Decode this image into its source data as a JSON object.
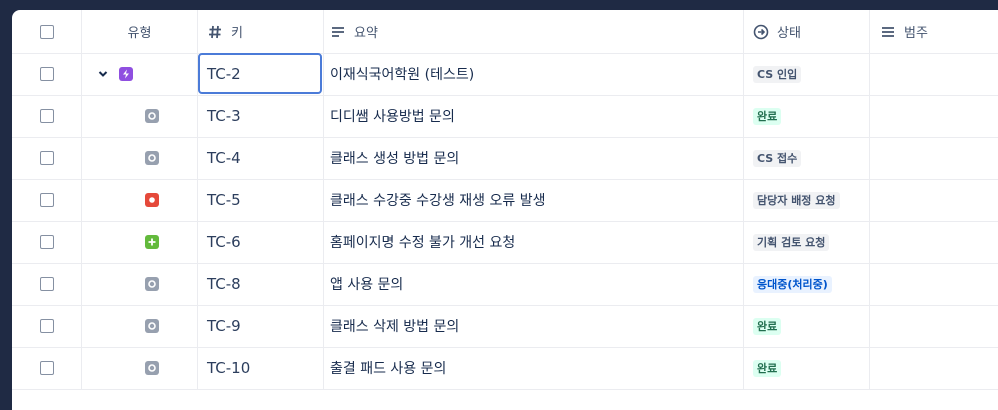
{
  "header": {
    "type_label": "유형",
    "key_label": "키",
    "summary_label": "요약",
    "status_label": "상태",
    "category_label": "범주"
  },
  "icons": {
    "key_header": "hash-icon",
    "summary_header": "text-lines-icon",
    "status_header": "arrow-circle-right-icon",
    "category_header": "menu-lines-icon"
  },
  "colors": {
    "epic": "#8f4fe0",
    "task": "#97a0af",
    "bug": "#e5493a",
    "improvement": "#63ba3c",
    "selection": "#4b7bd8"
  },
  "rows": [
    {
      "key": "TC-2",
      "summary": "이재식국어학원 (테스트)",
      "status": "CS 인입",
      "status_style": "gray",
      "type": "epic",
      "expanded": true
    },
    {
      "key": "TC-3",
      "summary": "디디쌤 사용방법 문의",
      "status": "완료",
      "status_style": "green",
      "type": "task"
    },
    {
      "key": "TC-4",
      "summary": "클래스 생성 방법 문의",
      "status": "CS 접수",
      "status_style": "gray",
      "type": "task"
    },
    {
      "key": "TC-5",
      "summary": "클래스 수강중 수강생 재생 오류 발생",
      "status": "담당자 배정 요청",
      "status_style": "gray",
      "type": "bug"
    },
    {
      "key": "TC-6",
      "summary": "홈페이지명 수정 불가 개선 요청",
      "status": "기획 검토 요청",
      "status_style": "gray",
      "type": "improvement"
    },
    {
      "key": "TC-8",
      "summary": "앱 사용 문의",
      "status": "응대중(처리중)",
      "status_style": "blue",
      "type": "task"
    },
    {
      "key": "TC-9",
      "summary": "클래스 삭제 방법 문의",
      "status": "완료",
      "status_style": "green",
      "type": "task"
    },
    {
      "key": "TC-10",
      "summary": "출결 패드 사용 문의",
      "status": "완료",
      "status_style": "green",
      "type": "task"
    }
  ]
}
